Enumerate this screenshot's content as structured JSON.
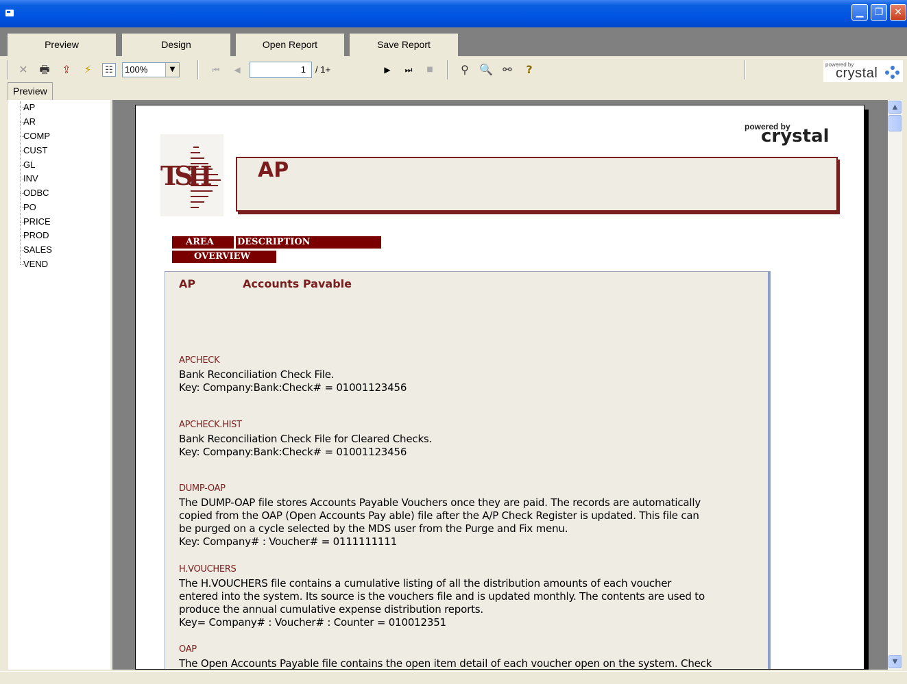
{
  "window": {
    "title": "",
    "controls": {
      "minimize": "▁",
      "restore": "❐",
      "close": "✕"
    }
  },
  "tabs": [
    {
      "label": "Preview"
    },
    {
      "label": "Design"
    },
    {
      "label": "Open Report"
    },
    {
      "label": "Save Report"
    }
  ],
  "toolbar": {
    "zoom": "100%",
    "page_current": "1",
    "page_total": "/ 1+",
    "powered_small": "powered by",
    "powered_brand": "crystal",
    "icons": [
      "close-icon",
      "print-icon",
      "export-icon",
      "refresh-icon",
      "group-tree-icon",
      "first-page-icon",
      "prev-page-icon",
      "next-page-icon",
      "last-page-icon",
      "stop-icon",
      "search-expert-icon",
      "search-icon",
      "find-icon",
      "help-icon"
    ]
  },
  "tree": {
    "tab_label": "Preview",
    "items": [
      "AP",
      "AR",
      "COMP",
      "CUST",
      "GL",
      "INV",
      "ODBC",
      "PO",
      "PRICE",
      "PROD",
      "SALES",
      "VEND"
    ]
  },
  "report": {
    "powered_small": "powered by",
    "powered_brand": "crystal",
    "logo_text": "TSH",
    "title": "AP",
    "headers": {
      "area": "AREA",
      "description": "DESCRIPTION",
      "overview": "OVERVIEW"
    },
    "area_code": "AP",
    "area_description": "Accounts Pavable",
    "entries": [
      {
        "name": "APCHECK",
        "desc": "Bank Reconciliation Check File.\nKey: Company:Bank:Check# = 01001123456"
      },
      {
        "name": "APCHECK.HIST",
        "desc": "Bank Reconciliation Check File for Cleared Checks.\nKey: Company:Bank:Check# = 01001123456"
      },
      {
        "name": "DUMP-OAP",
        "desc": "The DUMP-OAP file stores Accounts Payable Vouchers once they are paid. The records are automatically\ncopied from the OAP (Open Accounts Pay able) file after the A/P Check Register is updated. This file can\nbe purged on a cycle selected by the MDS user from the Purge and Fix menu.\nKey: Company# : Voucher# = 0111111111"
      },
      {
        "name": "H.VOUCHERS",
        "desc": "The H.VOUCHERS file contains a cumulative listing of all the  distribution amounts of each voucher\nentered into the system. Its source is the vouchers file and is updated monthly. The contents are used to\nproduce the annual cumulative expense distribution reports.\nKey= Company# : Voucher# : Counter = 010012351"
      },
      {
        "name": "OAP",
        "desc": "The Open Accounts Payable file contains the open item detail of each voucher open on the system. Check"
      }
    ]
  },
  "colors": {
    "titlebar": "#0054e3",
    "accent_maroon": "#7a1d1d",
    "header_bar": "#7a0000",
    "panel_bg": "#ece9d8"
  }
}
